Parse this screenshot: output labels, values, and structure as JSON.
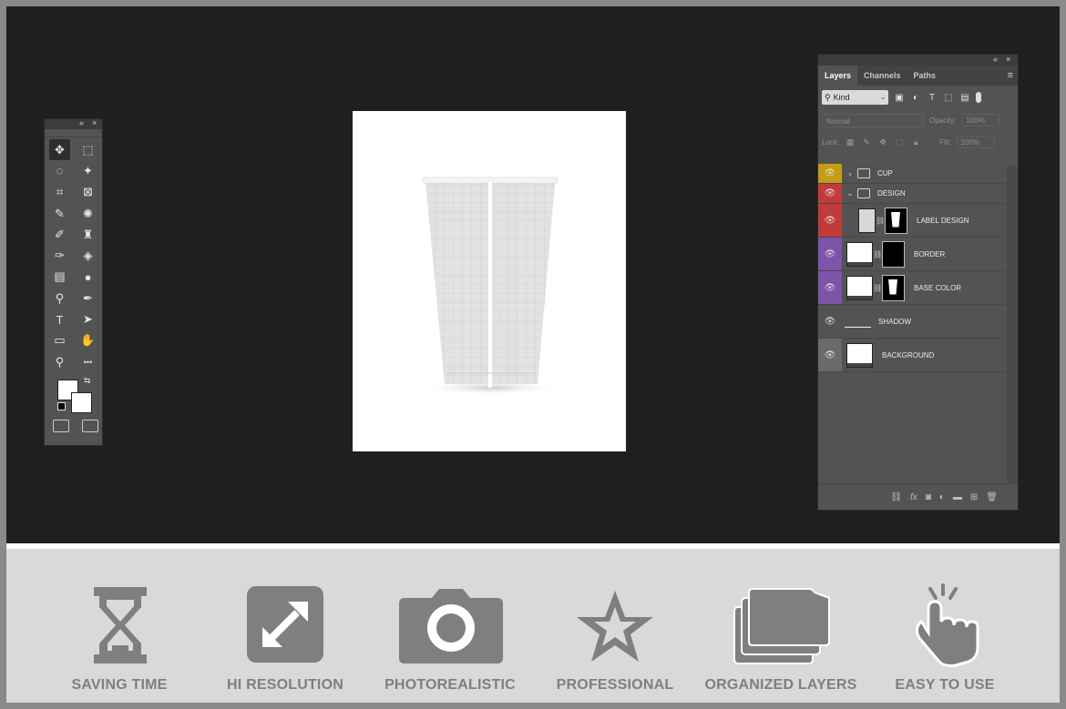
{
  "toolbox": {
    "controls": [
      "«",
      "×"
    ],
    "tools": [
      {
        "name": "move-tool-icon",
        "glyph": "✥",
        "active": true
      },
      {
        "name": "rect-marquee-icon",
        "glyph": "⬚"
      },
      {
        "name": "lasso-icon",
        "glyph": "◌"
      },
      {
        "name": "magic-wand-icon",
        "glyph": "✦"
      },
      {
        "name": "crop-icon",
        "glyph": "⌗"
      },
      {
        "name": "frame-icon",
        "glyph": "⊠"
      },
      {
        "name": "eyedropper-icon",
        "glyph": "✎"
      },
      {
        "name": "patch-icon",
        "glyph": "✺"
      },
      {
        "name": "brush-icon",
        "glyph": "✐"
      },
      {
        "name": "stamp-icon",
        "glyph": "♜"
      },
      {
        "name": "history-brush-icon",
        "glyph": "✑"
      },
      {
        "name": "eraser-icon",
        "glyph": "◈"
      },
      {
        "name": "gradient-icon",
        "glyph": "▤"
      },
      {
        "name": "blur-icon",
        "glyph": "●"
      },
      {
        "name": "dodge-icon",
        "glyph": "⚲"
      },
      {
        "name": "pen-icon",
        "glyph": "✒"
      },
      {
        "name": "type-icon",
        "glyph": "T"
      },
      {
        "name": "path-select-icon",
        "glyph": "➤"
      },
      {
        "name": "rectangle-shape-icon",
        "glyph": "▭"
      },
      {
        "name": "hand-icon",
        "glyph": "✋"
      },
      {
        "name": "zoom-icon",
        "glyph": "⚲"
      },
      {
        "name": "more-tools-icon",
        "glyph": "•••"
      }
    ]
  },
  "layers_panel": {
    "controls": [
      "«",
      "×"
    ],
    "tabs": [
      "Layers",
      "Channels",
      "Paths"
    ],
    "filter_kind": "Kind",
    "blend_mode": "Normal",
    "opacity_label": "Opacity:",
    "opacity_value": "100%",
    "lock_label": "Lock:",
    "fill_label": "Fill:",
    "fill_value": "100%",
    "layers": [
      {
        "name": "CUP",
        "kind": "group",
        "expanded": false,
        "color": "#c59c14"
      },
      {
        "name": "DESIGN",
        "kind": "group",
        "expanded": true,
        "color": "#c23b3b"
      },
      {
        "name": "LABEL DESIGN",
        "kind": "smart",
        "color": "#c23b3b"
      },
      {
        "name": "BORDER",
        "kind": "masked",
        "color": "#7d54a8"
      },
      {
        "name": "BASE COLOR",
        "kind": "masked",
        "color": "#7d54a8"
      },
      {
        "name": "SHADOW",
        "kind": "plain",
        "color": null
      },
      {
        "name": "BACKGROUND",
        "kind": "background",
        "color": "#6a6a6a"
      }
    ],
    "bottom_icons": [
      "link-layers-icon",
      "fx-icon",
      "add-mask-icon",
      "adjustment-layer-icon",
      "new-group-icon",
      "new-layer-icon",
      "delete-layer-icon"
    ]
  },
  "features": [
    {
      "label": "SAVING TIME",
      "icon": "hourglass-icon"
    },
    {
      "label": "HI RESOLUTION",
      "icon": "expand-arrows-icon"
    },
    {
      "label": "PHOTOREALISTIC",
      "icon": "camera-icon"
    },
    {
      "label": "PROFESSIONAL",
      "icon": "star-icon"
    },
    {
      "label": "ORGANIZED LAYERS",
      "icon": "stacked-folders-icon"
    },
    {
      "label": "EASY TO USE",
      "icon": "pointing-hand-icon"
    }
  ],
  "colors": {
    "workspace": "#1f1f1f",
    "panel": "#535353",
    "feature_gray": "#7f7f7f",
    "features_bg": "#d9d9d9"
  }
}
